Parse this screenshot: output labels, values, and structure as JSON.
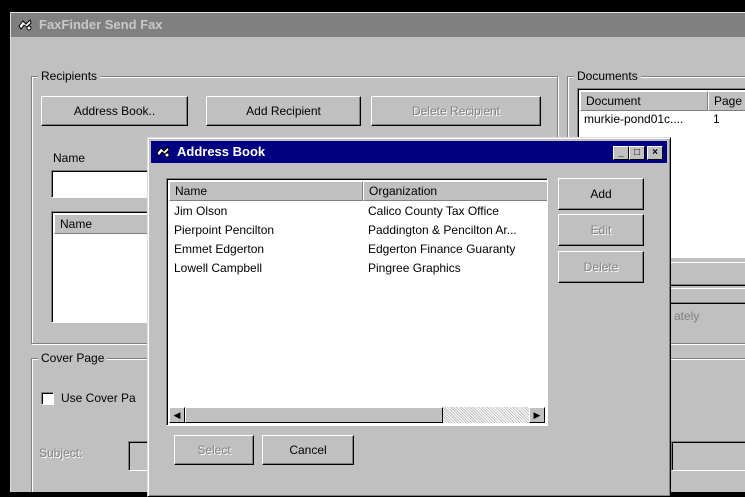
{
  "main_window": {
    "title": "FaxFinder Send Fax",
    "recipients": {
      "legend": "Recipients",
      "address_book_button": "Address Book..",
      "add_recipient_button": "Add Recipient",
      "delete_recipient_button": "Delete Recipient",
      "name_label": "Name",
      "list_header_name": "Name"
    },
    "documents": {
      "legend": "Documents",
      "col_document": "Document",
      "col_pages": "Page",
      "rows": [
        {
          "document": "murkie-pond01c....",
          "pages": "1"
        }
      ]
    },
    "partial_text": "ately",
    "cover_page": {
      "legend": "Cover Page",
      "use_cover_page_label": "Use Cover Pa",
      "subject_label": "Subject:"
    }
  },
  "address_book": {
    "title": "Address Book",
    "columns": {
      "name": "Name",
      "organization": "Organization"
    },
    "contacts": [
      {
        "name": "Jim Olson",
        "organization": "Calico County Tax Office"
      },
      {
        "name": "Pierpoint Pencilton",
        "organization": "Paddington & Pencilton Ar..."
      },
      {
        "name": "Emmet Edgerton",
        "organization": "Edgerton Finance Guaranty"
      },
      {
        "name": "Lowell Campbell",
        "organization": "Pingree Graphics"
      }
    ],
    "buttons": {
      "add": "Add",
      "edit": "Edit",
      "delete": "Delete",
      "select": "Select",
      "cancel": "Cancel"
    },
    "window_controls": {
      "minimize": "_",
      "maximize": "□",
      "close": "×"
    }
  }
}
